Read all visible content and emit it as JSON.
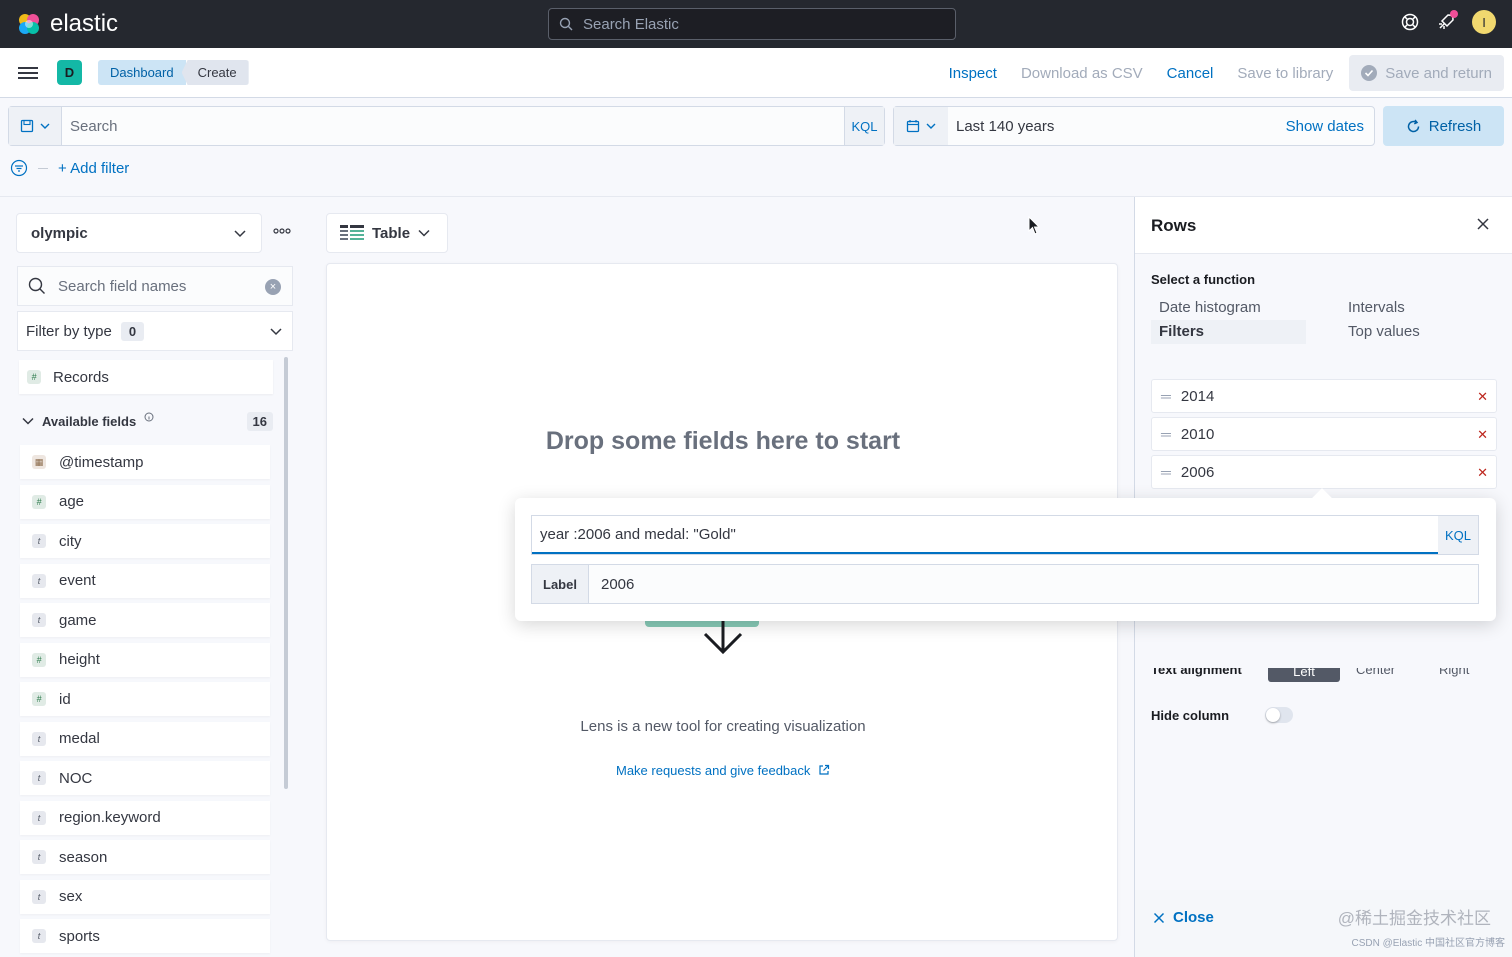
{
  "brand": {
    "name": "elastic"
  },
  "global_search": {
    "placeholder": "Search Elastic"
  },
  "user": {
    "initial": "I"
  },
  "space": {
    "initial": "D"
  },
  "breadcrumbs": [
    "Dashboard",
    "Create"
  ],
  "header_actions": {
    "inspect": "Inspect",
    "download_csv": "Download as CSV",
    "cancel": "Cancel",
    "save_library": "Save to library",
    "save_return": "Save and return"
  },
  "query_bar": {
    "placeholder": "Search",
    "language": "KQL"
  },
  "date_picker": {
    "range": "Last 140 years",
    "show_dates": "Show dates"
  },
  "refresh": {
    "label": "Refresh"
  },
  "filters": {
    "add_filter": "+ Add filter"
  },
  "left_panel": {
    "index_pattern": "olympic",
    "field_search_placeholder": "Search field names",
    "filter_by_type": "Filter by type",
    "filter_count": "0",
    "records": "Records",
    "available_fields_label": "Available fields",
    "available_count": "16",
    "fields": [
      {
        "name": "@timestamp",
        "type": "date",
        "glyph": "▦"
      },
      {
        "name": "age",
        "type": "number",
        "glyph": "#"
      },
      {
        "name": "city",
        "type": "string",
        "glyph": "t"
      },
      {
        "name": "event",
        "type": "string",
        "glyph": "t"
      },
      {
        "name": "game",
        "type": "string",
        "glyph": "t"
      },
      {
        "name": "height",
        "type": "number",
        "glyph": "#"
      },
      {
        "name": "id",
        "type": "number",
        "glyph": "#"
      },
      {
        "name": "medal",
        "type": "string",
        "glyph": "t"
      },
      {
        "name": "NOC",
        "type": "string",
        "glyph": "t"
      },
      {
        "name": "region.keyword",
        "type": "string",
        "glyph": "t"
      },
      {
        "name": "season",
        "type": "string",
        "glyph": "t"
      },
      {
        "name": "sex",
        "type": "string",
        "glyph": "t"
      },
      {
        "name": "sports",
        "type": "string",
        "glyph": "t"
      }
    ]
  },
  "workspace": {
    "chart_type": "Table",
    "drop_title": "Drop some fields here to start",
    "lens_text": "Lens is a new tool for creating visualization",
    "feedback_link": "Make requests and give feedback"
  },
  "flyout": {
    "title": "Rows",
    "select_function": "Select a function",
    "functions": [
      "Date histogram",
      "Intervals",
      "Filters",
      "Top values"
    ],
    "active_function": "Filters",
    "filter_items": [
      "2014",
      "2010",
      "2006"
    ],
    "text_alignment_label": "Text alignment",
    "alignment_options": [
      "Left",
      "Center",
      "Right"
    ],
    "hide_column": "Hide column",
    "close": "Close",
    "watermark": "@稀土掘金技术社区",
    "watermark_small": "CSDN @Elastic 中国社区官方博客"
  },
  "popover": {
    "query": "year :2006 and medal: \"Gold\"",
    "language": "KQL",
    "label_prefix": "Label",
    "label_value": "2006"
  },
  "colors": {
    "accent": "#0071c2",
    "danger": "#bd271e",
    "topbar": "#25282f",
    "space": "#14b8a6"
  }
}
